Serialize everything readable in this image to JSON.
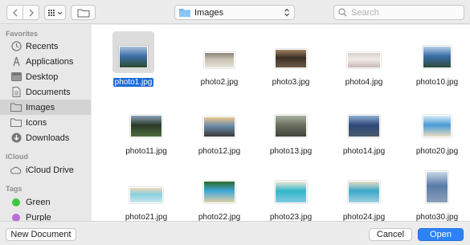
{
  "toolbar": {
    "location_label": "Images",
    "search_placeholder": "Search"
  },
  "sidebar": {
    "favorites_header": "Favorites",
    "favorites": [
      {
        "label": "Recents",
        "icon": "clock-icon"
      },
      {
        "label": "Applications",
        "icon": "applications-icon"
      },
      {
        "label": "Desktop",
        "icon": "desktop-icon"
      },
      {
        "label": "Documents",
        "icon": "documents-icon"
      },
      {
        "label": "Images",
        "icon": "folder-icon",
        "selected": true
      },
      {
        "label": "Icons",
        "icon": "folder-icon"
      },
      {
        "label": "Downloads",
        "icon": "downloads-icon"
      }
    ],
    "icloud_header": "iCloud",
    "icloud": [
      {
        "label": "iCloud Drive",
        "icon": "cloud-icon"
      }
    ],
    "tags_header": "Tags",
    "tags": [
      {
        "label": "Green",
        "color": "#3dc93d"
      },
      {
        "label": "Purple",
        "color": "#b86ed6"
      }
    ]
  },
  "files": [
    {
      "name": "photo1.jpg",
      "selected": true,
      "colors": [
        "#3e6fa8",
        "#a8c2dc",
        "#2b4a2e"
      ]
    },
    {
      "name": "photo2.jpg",
      "colors": [
        "#c9c3b5",
        "#8a8476",
        "#e6e2d8"
      ]
    },
    {
      "name": "photo3.jpg",
      "colors": [
        "#3a2e24",
        "#a08462",
        "#6d5a46"
      ]
    },
    {
      "name": "photo4.jpg",
      "colors": [
        "#f0ece8",
        "#d8d0cc",
        "#c8b8b4"
      ]
    },
    {
      "name": "photo10.jpg",
      "colors": [
        "#3a6ea8",
        "#b8d0e8",
        "#2e4a3a"
      ]
    },
    {
      "name": "photo11.jpg",
      "colors": [
        "#2c3a2a",
        "#8aa2b8",
        "#4e6a3a"
      ]
    },
    {
      "name": "photo12.jpg",
      "colors": [
        "#6a8aa8",
        "#e8c890",
        "#3a3a3a"
      ]
    },
    {
      "name": "photo13.jpg",
      "colors": [
        "#6a7060",
        "#a8b0a0",
        "#3e4438"
      ]
    },
    {
      "name": "photo14.jpg",
      "colors": [
        "#2e4a7a",
        "#90aed0",
        "#4a5a6a"
      ]
    },
    {
      "name": "photo20.jpg",
      "colors": [
        "#4a9ad8",
        "#d8ecf6",
        "#e8dcc0"
      ]
    },
    {
      "name": "photo21.jpg",
      "colors": [
        "#8ad0e0",
        "#e8d8b8",
        "#c8e8f0"
      ]
    },
    {
      "name": "photo22.jpg",
      "colors": [
        "#40a8d8",
        "#2a6a2a",
        "#e0d0a8"
      ]
    },
    {
      "name": "photo23.jpg",
      "colors": [
        "#30b8c8",
        "#f0e8d8",
        "#80c8e0"
      ]
    },
    {
      "name": "photo24.jpg",
      "colors": [
        "#3aa8c8",
        "#e8dcc4",
        "#a0d0e0"
      ]
    },
    {
      "name": "photo30.jpg",
      "colors": [
        "#5a7aa8",
        "#c8d8e8",
        "#8aa0b8"
      ]
    }
  ],
  "buttons": {
    "new_document": "New Document",
    "cancel": "Cancel",
    "open": "Open"
  }
}
